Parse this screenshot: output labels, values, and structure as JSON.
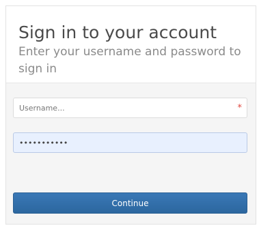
{
  "signin": {
    "title": "Sign in to your account",
    "subtitle": "Enter your username and password to sign in",
    "username": {
      "placeholder": "Username...",
      "value": "",
      "required_mark": "*"
    },
    "password": {
      "value": "•••••••••••",
      "masked": true
    },
    "continue_label": "Continue"
  },
  "colors": {
    "accent": "#2c679f",
    "required": "#e0473f",
    "autofill": "#e8f0fe"
  }
}
